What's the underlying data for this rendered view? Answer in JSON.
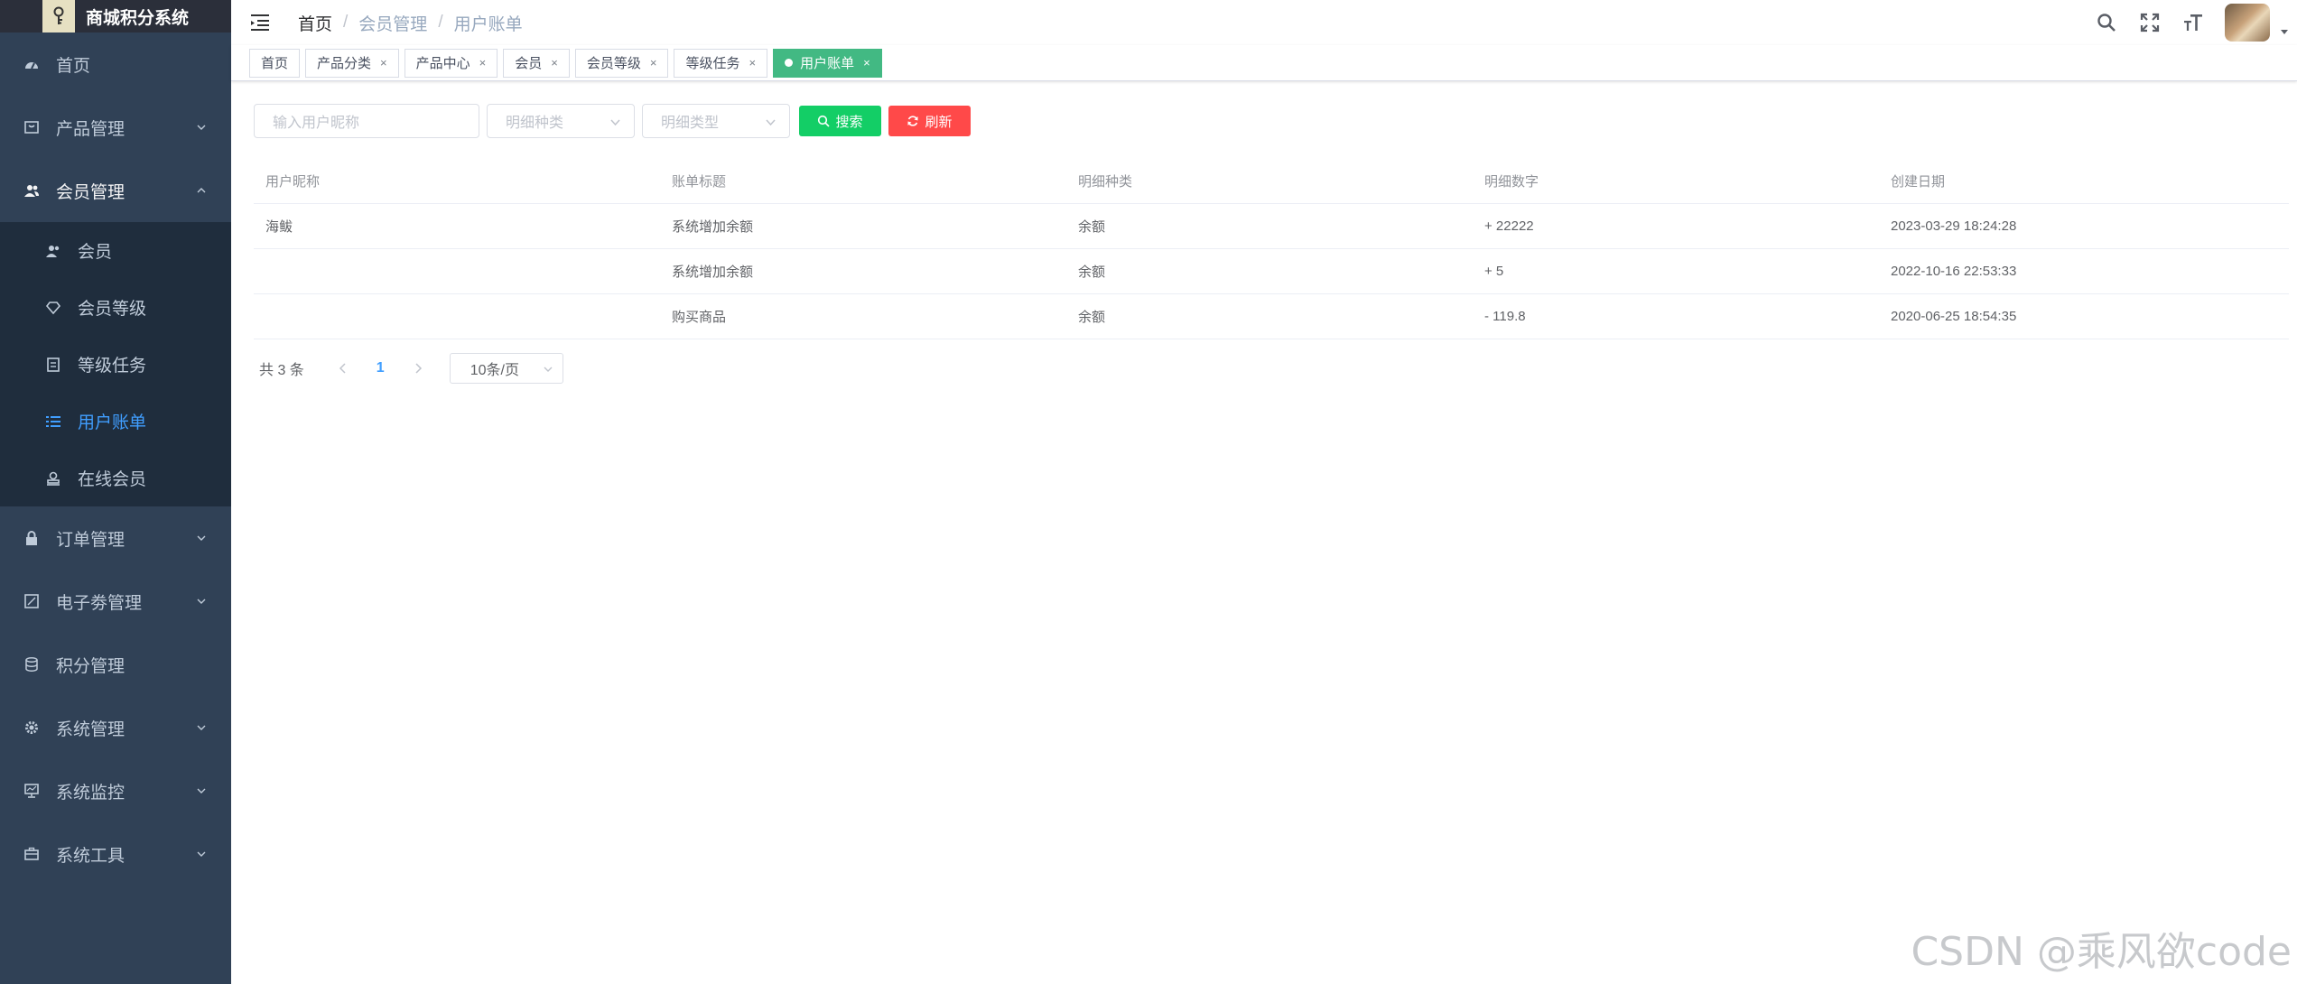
{
  "app": {
    "title": "商城积分系统",
    "logo_icon": "key-icon"
  },
  "sidebar": {
    "items": [
      {
        "label": "首页",
        "icon": "dashboard-icon"
      },
      {
        "label": "产品管理",
        "icon": "box-icon"
      },
      {
        "label": "会员管理",
        "icon": "users-icon",
        "expanded": true,
        "children": [
          {
            "label": "会员",
            "icon": "user-icon"
          },
          {
            "label": "会员等级",
            "icon": "diamond-icon"
          },
          {
            "label": "等级任务",
            "icon": "task-icon"
          },
          {
            "label": "用户账单",
            "icon": "list-icon",
            "active": true
          },
          {
            "label": "在线会员",
            "icon": "online-icon"
          }
        ]
      },
      {
        "label": "订单管理",
        "icon": "lock-icon"
      },
      {
        "label": "电子劵管理",
        "icon": "coupon-icon"
      },
      {
        "label": "积分管理",
        "icon": "database-icon"
      },
      {
        "label": "系统管理",
        "icon": "gear-icon"
      },
      {
        "label": "系统监控",
        "icon": "monitor-icon"
      },
      {
        "label": "系统工具",
        "icon": "toolbox-icon"
      }
    ]
  },
  "header": {
    "breadcrumb": [
      "首页",
      "会员管理",
      "用户账单"
    ]
  },
  "tags": [
    {
      "label": "首页",
      "closable": false
    },
    {
      "label": "产品分类",
      "closable": true
    },
    {
      "label": "产品中心",
      "closable": true
    },
    {
      "label": "会员",
      "closable": true
    },
    {
      "label": "会员等级",
      "closable": true
    },
    {
      "label": "等级任务",
      "closable": true
    },
    {
      "label": "用户账单",
      "closable": true,
      "active": true
    }
  ],
  "filters": {
    "nickname_placeholder": "输入用户昵称",
    "detail_kind_placeholder": "明细种类",
    "detail_type_placeholder": "明细类型",
    "search_label": "搜索",
    "refresh_label": "刷新"
  },
  "table": {
    "columns": [
      "用户昵称",
      "账单标题",
      "明细种类",
      "明细数字",
      "创建日期"
    ],
    "rows": [
      [
        "海鲅",
        "系统增加余额",
        "余额",
        "+ 22222",
        "2023-03-29 18:24:28"
      ],
      [
        "",
        "系统增加余额",
        "余额",
        "+ 5",
        "2022-10-16 22:53:33"
      ],
      [
        "",
        "购买商品",
        "余额",
        "- 119.8",
        "2020-06-25 18:54:35"
      ]
    ]
  },
  "pagination": {
    "total_text": "共 3 条",
    "current_page": "1",
    "page_size": "10条/页"
  },
  "watermark": "CSDN @乘风欲code",
  "colors": {
    "sidebar_bg": "#304156",
    "submenu_bg": "#1f2d3d",
    "active_menu": "#409eff",
    "tag_active": "#42b983",
    "search_btn": "#13ce66",
    "refresh_btn": "#ff4949"
  }
}
